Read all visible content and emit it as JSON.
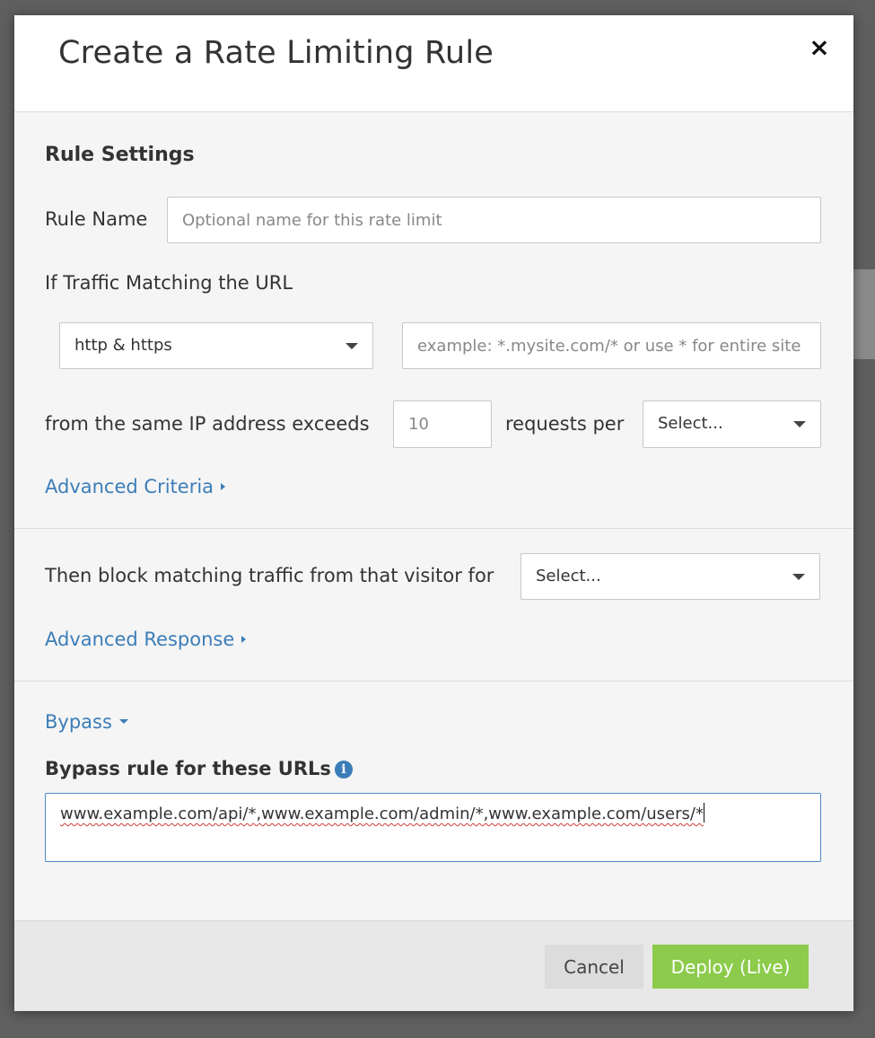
{
  "modal": {
    "title": "Create a Rate Limiting Rule",
    "close_glyph": "×"
  },
  "rule_settings": {
    "section_title": "Rule Settings",
    "rule_name_label": "Rule Name",
    "rule_name_placeholder": "Optional name for this rate limit",
    "url_match_label": "If Traffic Matching the URL",
    "protocol_select_value": "http & https",
    "url_placeholder": "example: *.mysite.com/* or use * for entire site",
    "ip_exceeds_label": "from the same IP address exceeds",
    "requests_value": "10",
    "requests_per_label": "requests per",
    "period_select_value": "Select...",
    "advanced_criteria_link": "Advanced Criteria"
  },
  "response": {
    "block_label": "Then block matching traffic from that visitor for",
    "block_select_value": "Select...",
    "advanced_response_link": "Advanced Response"
  },
  "bypass": {
    "toggle_label": "Bypass",
    "urls_label": "Bypass rule for these URLs",
    "info_icon_glyph": "i",
    "urls_value": "www.example.com/api/*,www.example.com/admin/*,www.example.com/users/*"
  },
  "footer": {
    "cancel_label": "Cancel",
    "deploy_label": "Deploy (Live)"
  },
  "colors": {
    "link": "#3b7db8",
    "deploy_button": "#8ccb4b",
    "focused_border": "#4e8ac8"
  }
}
